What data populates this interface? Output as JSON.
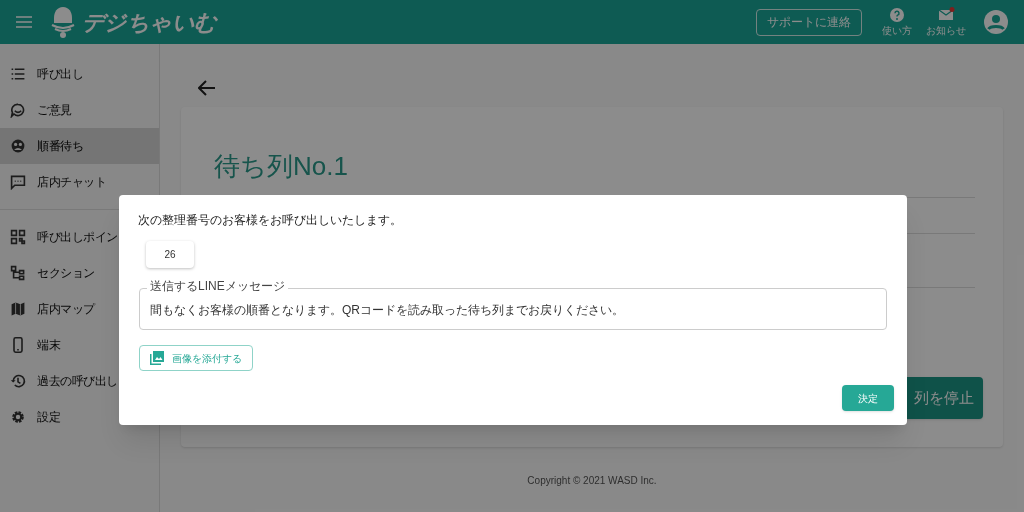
{
  "header": {
    "logo_text": "デジちゃいむ",
    "support_button": "サポートに連絡",
    "actions": [
      {
        "kind": "help",
        "label": "使い方",
        "badge": false
      },
      {
        "kind": "mail",
        "label": "お知らせ",
        "badge": true
      }
    ]
  },
  "sidebar": {
    "groups": [
      [
        {
          "label": "呼び出し",
          "selected": false
        },
        {
          "label": "ご意見",
          "selected": false
        },
        {
          "label": "順番待ち",
          "selected": true
        },
        {
          "label": "店内チャット",
          "selected": false
        }
      ],
      [
        {
          "label": "呼び出しポイン",
          "selected": false
        },
        {
          "label": "セクション",
          "selected": false
        },
        {
          "label": "店内マップ",
          "selected": false
        },
        {
          "label": "端末",
          "selected": false
        },
        {
          "label": "過去の呼び出し",
          "selected": false
        },
        {
          "label": "設定",
          "selected": false
        }
      ]
    ]
  },
  "main": {
    "title": "待ち列No.1",
    "stop_button": "列を停止",
    "footer": "Copyright © 2021 WASD Inc."
  },
  "dialog": {
    "message": "次の整理番号のお客様をお呼び出しいたします。",
    "number": "26",
    "line_field": {
      "label": "送信するLINEメッセージ",
      "value": "間もなくお客様の順番となります。QRコードを読み取った待ち列までお戻りください。"
    },
    "attach_button": "画像を添付する",
    "confirm_button": "決定"
  }
}
